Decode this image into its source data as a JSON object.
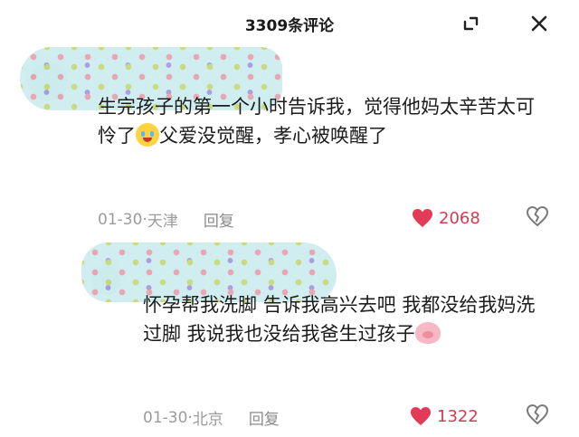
{
  "header": {
    "title": "3309条评论",
    "expand_icon": "expand-icon",
    "close_icon": "close-icon"
  },
  "comments": [
    {
      "text_a": "生完孩子的第一个小时告诉我，觉得他妈太辛苦太可怜了",
      "emoji": "crying-laughing-emoji",
      "text_b": "父爱没觉醒，孝心被唤醒了",
      "date": "01-30",
      "separator": " · ",
      "location": "天津",
      "reply_label": "回复",
      "likes": "2068"
    },
    {
      "text_a": "怀孕帮我洗脚 告诉我高兴去吧 我都没给我妈洗过脚 我说我也没给我爸生过孩子",
      "emoji": "pig-face-emoji",
      "text_b": "",
      "date": "01-30",
      "separator": " · ",
      "location": "北京",
      "reply_label": "回复",
      "likes": "1322"
    }
  ],
  "colors": {
    "like_red": "#d63a52",
    "meta_gray": "#9b9b9b"
  }
}
